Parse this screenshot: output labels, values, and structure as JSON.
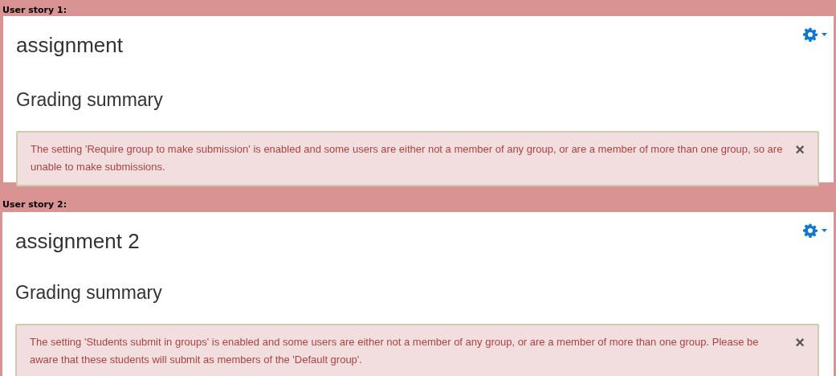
{
  "stories": [
    {
      "label": "User story 1:",
      "page_title": "assignment",
      "section_heading": "Grading summary",
      "alert": {
        "message": "The setting 'Require group to make submission' is enabled and some users are either not a member of any group, or are a member of more than one group, so are unable to make submissions.",
        "close": "×"
      }
    },
    {
      "label": "User story 2:",
      "page_title": "assignment 2",
      "section_heading": "Grading summary",
      "alert": {
        "message": "The setting 'Students submit in groups' is enabled and some users are either not a member of any group, or are a member of more than one group. Please be aware that these students will submit as members of the 'Default group'.",
        "close": "×"
      }
    }
  ]
}
